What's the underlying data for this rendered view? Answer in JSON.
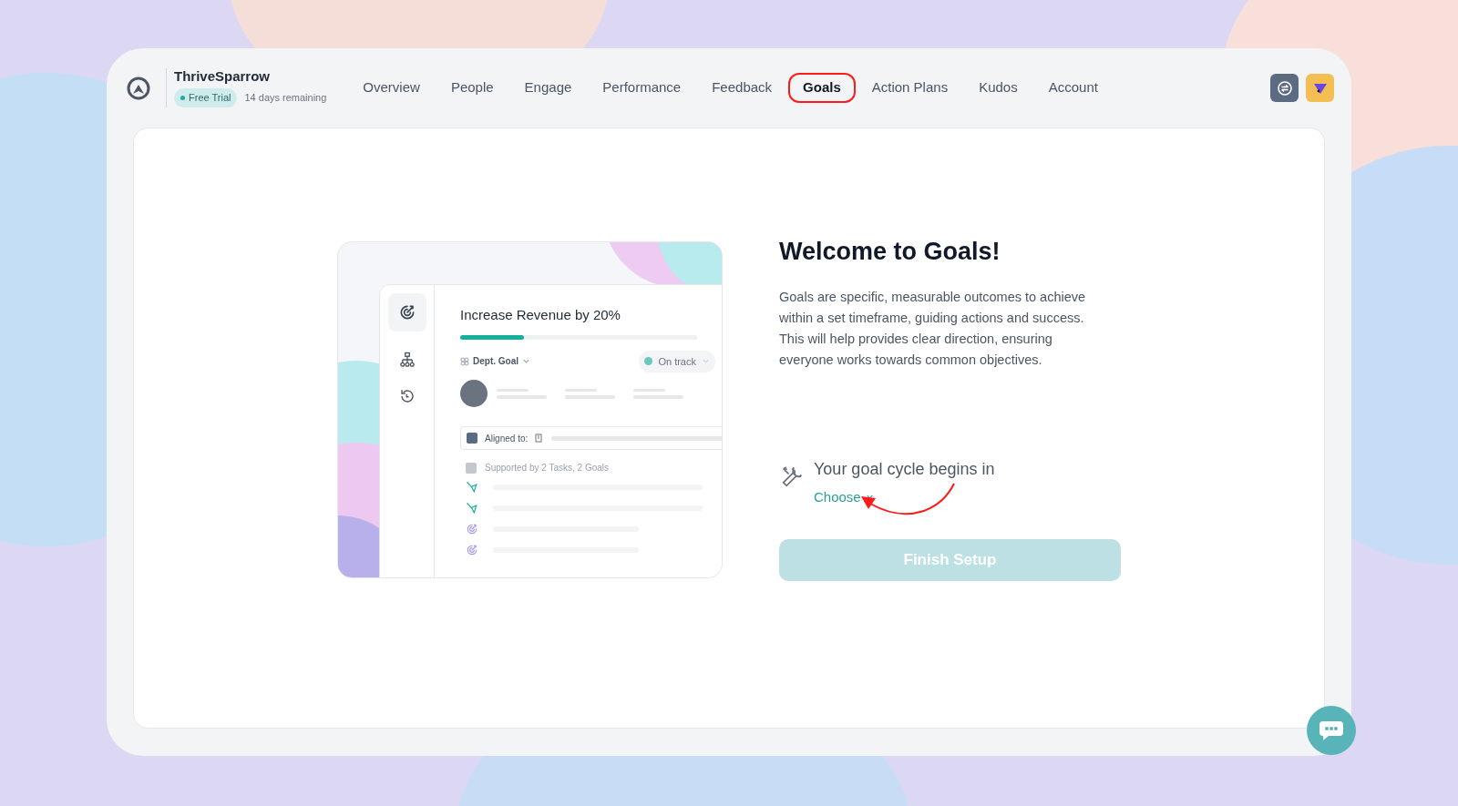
{
  "brand": {
    "name": "ThriveSparrow",
    "plan_badge": "Free Trial",
    "trial_note": "14 days remaining"
  },
  "nav": [
    {
      "label": "Overview",
      "selected": false
    },
    {
      "label": "People",
      "selected": false
    },
    {
      "label": "Engage",
      "selected": false
    },
    {
      "label": "Performance",
      "selected": false
    },
    {
      "label": "Feedback",
      "selected": false
    },
    {
      "label": "Goals",
      "selected": true
    },
    {
      "label": "Action Plans",
      "selected": false
    },
    {
      "label": "Kudos",
      "selected": false
    },
    {
      "label": "Account",
      "selected": false
    }
  ],
  "illustration": {
    "goal_title": "Increase Revenue by 20%",
    "progress": {
      "level": 0.27
    },
    "goal_type": "Dept. Goal",
    "status": "On track",
    "aligned_label": "Aligned to:",
    "supported_label": "Supported by 2 Tasks, 2 Goals",
    "supporting_items": [
      {
        "kind": "task"
      },
      {
        "kind": "task"
      },
      {
        "kind": "goal"
      },
      {
        "kind": "goal"
      }
    ]
  },
  "welcome": {
    "title": "Welcome to Goals!",
    "description": "Goals are specific, measurable outcomes to achieve within a set timeframe, guiding actions and success. This will help provides clear direction, ensuring everyone works towards common objectives.",
    "cycle_label": "Your goal cycle begins in",
    "cycle_select": "Choose",
    "finish_button": {
      "label": "Finish Setup",
      "disabled": true
    }
  }
}
